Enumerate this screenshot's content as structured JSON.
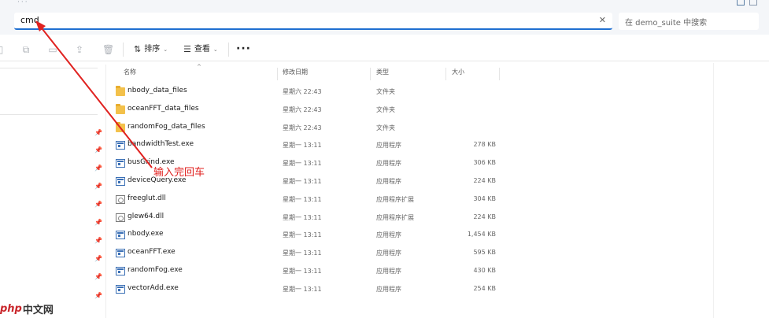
{
  "address_bar": {
    "value": "cmd",
    "clear_icon": "close-icon"
  },
  "search": {
    "placeholder": "在 demo_suite 中搜索"
  },
  "toolbar": {
    "sort_label": "排序",
    "view_label": "查看",
    "more_label": "···"
  },
  "columns": {
    "name": "名称",
    "date": "修改日期",
    "type": "类型",
    "size": "大小"
  },
  "files": [
    {
      "icon": "folder-icon",
      "name": "nbody_data_files",
      "date": "星期六 22:43",
      "type": "文件夹",
      "size": ""
    },
    {
      "icon": "folder-icon",
      "name": "oceanFFT_data_files",
      "date": "星期六 22:43",
      "type": "文件夹",
      "size": ""
    },
    {
      "icon": "folder-icon",
      "name": "randomFog_data_files",
      "date": "星期六 22:43",
      "type": "文件夹",
      "size": ""
    },
    {
      "icon": "exe-icon",
      "name": "bandwidthTest.exe",
      "date": "星期一 13:11",
      "type": "应用程序",
      "size": "278 KB"
    },
    {
      "icon": "exe-icon",
      "name": "busGrind.exe",
      "date": "星期一 13:11",
      "type": "应用程序",
      "size": "306 KB"
    },
    {
      "icon": "exe-icon",
      "name": "deviceQuery.exe",
      "date": "星期一 13:11",
      "type": "应用程序",
      "size": "224 KB"
    },
    {
      "icon": "dll-icon",
      "name": "freeglut.dll",
      "date": "星期一 13:11",
      "type": "应用程序扩展",
      "size": "304 KB"
    },
    {
      "icon": "dll-icon",
      "name": "glew64.dll",
      "date": "星期一 13:11",
      "type": "应用程序扩展",
      "size": "224 KB"
    },
    {
      "icon": "exe-icon",
      "name": "nbody.exe",
      "date": "星期一 13:11",
      "type": "应用程序",
      "size": "1,454 KB"
    },
    {
      "icon": "exe-icon",
      "name": "oceanFFT.exe",
      "date": "星期一 13:11",
      "type": "应用程序",
      "size": "595 KB"
    },
    {
      "icon": "exe-icon",
      "name": "randomFog.exe",
      "date": "星期一 13:11",
      "type": "应用程序",
      "size": "430 KB"
    },
    {
      "icon": "exe-icon",
      "name": "vectorAdd.exe",
      "date": "星期一 13:11",
      "type": "应用程序",
      "size": "254 KB"
    }
  ],
  "annotation": {
    "text": "输入完回车",
    "color": "#e0211f"
  },
  "watermark": {
    "logo": "php",
    "text": "中文网"
  },
  "colors": {
    "accent": "#1f6fd1",
    "folder": "#f3c14b",
    "annotation": "#e0211f"
  }
}
